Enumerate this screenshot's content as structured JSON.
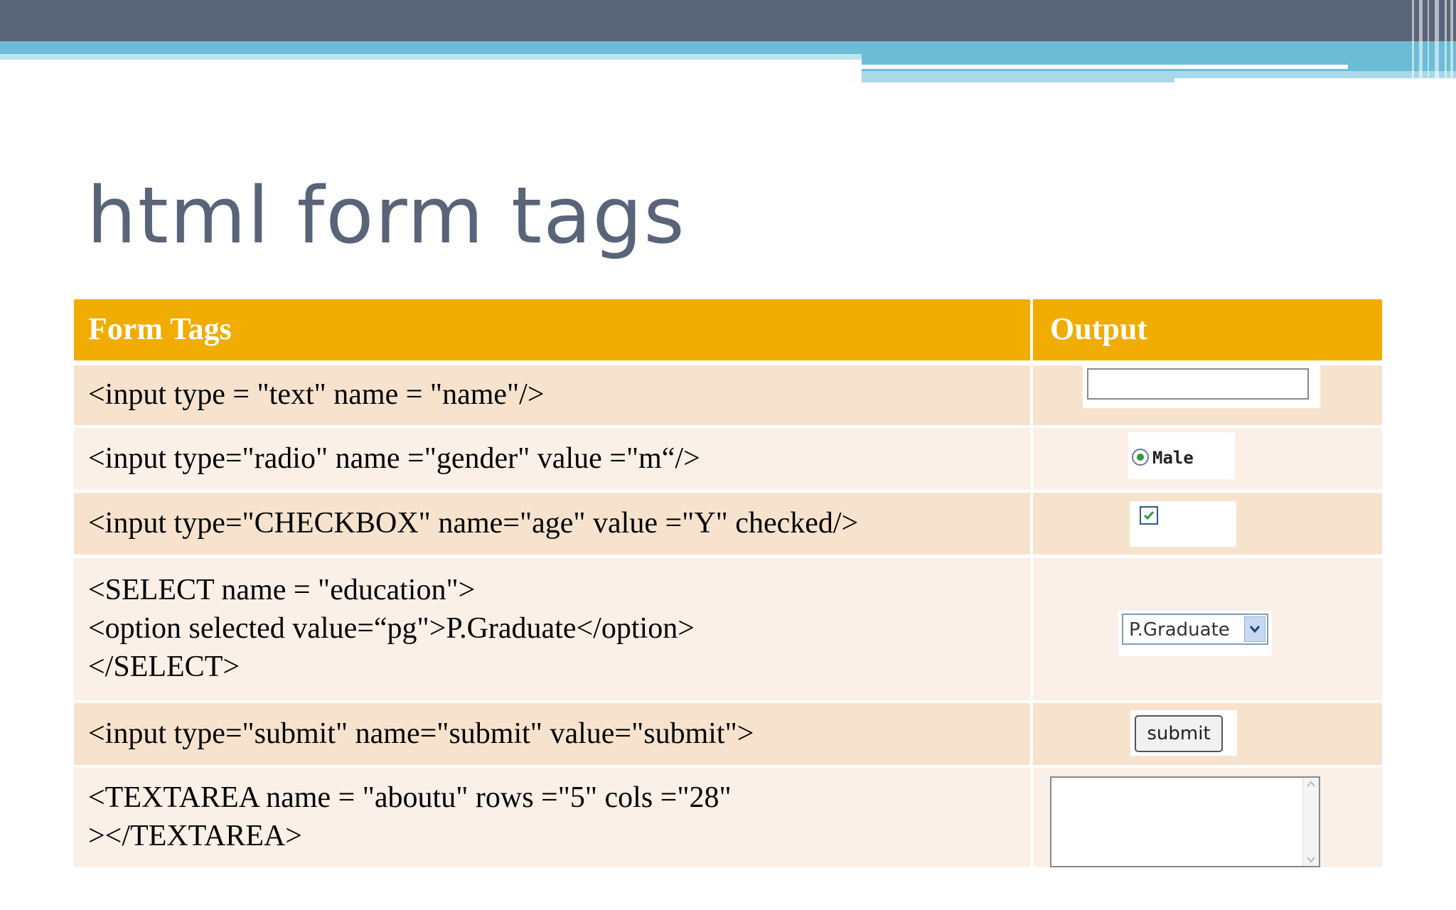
{
  "slide": {
    "title": "html form tags"
  },
  "table": {
    "headers": [
      "Form Tags",
      "Output"
    ],
    "rows": [
      {
        "code": "<input type = \"text\" name = \"name\"/>"
      },
      {
        "code": "<input type=\"radio\" name =\"gender\" value =\"m“/>",
        "output_label": "Male"
      },
      {
        "code": "<input type=\"CHECKBOX\" name=\"age\" value =\"Y\" checked/>"
      },
      {
        "code": "<SELECT name = \"education\">\n<option selected value=“pg\">P.Graduate</option>\n</SELECT>",
        "output_label": "P.Graduate"
      },
      {
        "code": "<input type=\"submit\" name=\"submit\" value=\"submit\">",
        "output_label": "submit"
      },
      {
        "code": "<TEXTAREA name = \"aboutu\" rows =\"5\" cols =\"28\"\n></TEXTAREA>"
      }
    ]
  },
  "colors": {
    "header_bg": "#f0ad00",
    "row_odd": "#f7e3cd",
    "row_even": "#fbf0e8",
    "title": "#5a6478",
    "top_bar_dark": "#5a6478",
    "top_bar_blue": "#6cbcd6"
  },
  "icons": {
    "radio": "radio-checked-icon",
    "checkbox": "checkbox-checked-icon",
    "select_arrow": "chevron-down-icon",
    "scroll_up": "scroll-up-icon",
    "scroll_down": "scroll-down-icon"
  }
}
